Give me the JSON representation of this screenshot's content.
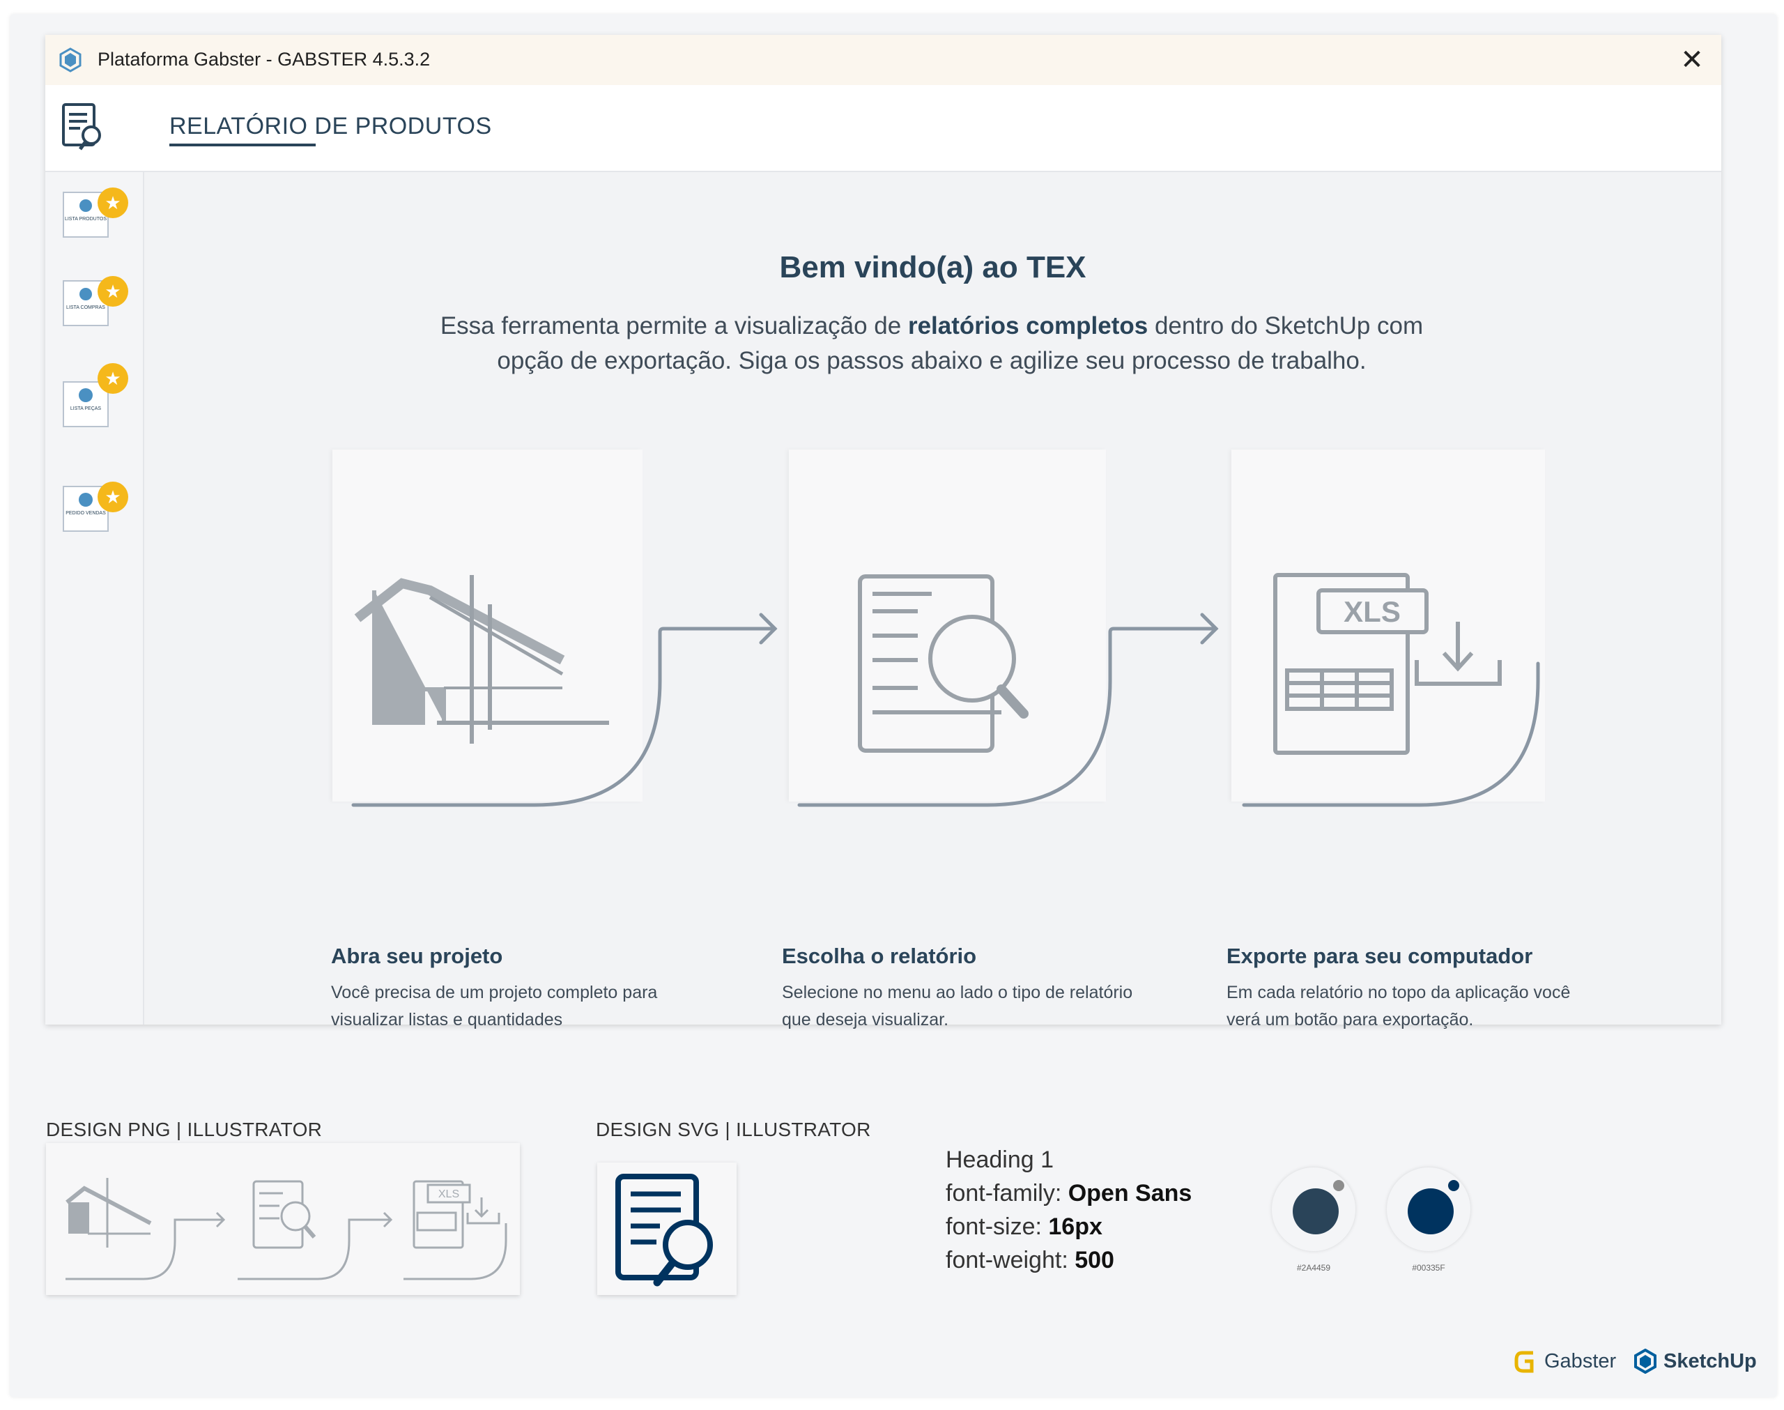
{
  "window": {
    "title": "Plataforma Gabster - GABSTER 4.5.3.2",
    "close_symbol": "✕"
  },
  "header": {
    "title": "RELATÓRIO DE PRODUTOS"
  },
  "sidebar": {
    "items": [
      {
        "label": "LISTA PRODUTOS",
        "icon": "list-products-icon"
      },
      {
        "label": "LISTA COMPRAS",
        "icon": "list-purchases-icon"
      },
      {
        "label": "LISTA PEÇAS",
        "icon": "list-parts-icon"
      },
      {
        "label": "PEDIDO VENDAS",
        "icon": "sales-order-icon"
      }
    ]
  },
  "main": {
    "welcome": "Bem vindo(a) ao TEX",
    "intro_part1": "Essa ferramenta permite a visualização de ",
    "intro_bold": "relatórios completos",
    "intro_part2": " dentro do SketchUp com opção de exportação. Siga os passos abaixo e agilize seu processo de trabalho.",
    "steps": [
      {
        "title": "Abra seu projeto",
        "desc": "Você precisa de um projeto completo para visualizar listas e quantidades",
        "icon": "house-plan-icon"
      },
      {
        "title": "Escolha o relatório",
        "desc": "Selecione no menu ao lado o tipo de relatório que deseja visualizar.",
        "icon": "report-search-icon"
      },
      {
        "title": "Exporte para seu computador",
        "desc": "Em cada relatório no topo da aplicação você verá um botão para exportação.",
        "icon": "xls-download-icon",
        "badge": "XLS"
      }
    ]
  },
  "design": {
    "png_label": "DESIGN PNG | ILLUSTRATOR",
    "svg_label": "DESIGN SVG | ILLUSTRATOR",
    "heading": "Heading 1",
    "font_family_label": "font-family: ",
    "font_family_value": "Open Sans",
    "font_size_label": "font-size: ",
    "font_size_value": "16px",
    "font_weight_label": "font-weight: ",
    "font_weight_value": "500",
    "colors": [
      {
        "hex": "#2A4459",
        "label": "#2A4459"
      },
      {
        "hex": "#00335F",
        "label": "#00335F"
      }
    ],
    "thumb_badge": "XLS"
  },
  "brands": {
    "gabster": "Gabster",
    "sketchup": "SketchUp"
  },
  "accent": "#2a4459",
  "star_color": "#f5b81b"
}
